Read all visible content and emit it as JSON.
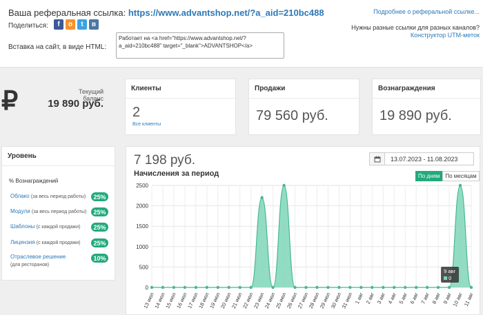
{
  "referral": {
    "label": "Ваша реферальная ссылка:",
    "url": "https://www.advantshop.net/?a_aid=210bc488",
    "more_link": "Подробнее о реферальной ссылке...",
    "share_label": "Поделиться:",
    "share_icons": [
      "facebook-icon",
      "odnoklassniki-icon",
      "twitter-icon",
      "vk-icon"
    ],
    "need_text": "Нужны разные ссылки для разных каналов?",
    "utm_link": "Конструктор UTM-меток",
    "embed_label": "Вставка на сайт, в виде HTML:",
    "embed_code": "Работает на <a href=\"https://www.advantshop.net/?a_aid=210bc488\" target=\"_blank\">ADVANTSHOP</a>"
  },
  "balance": {
    "currency_symbol": "₽",
    "label": "Текущий баланс",
    "value": "19 890 руб."
  },
  "stats": {
    "clients": {
      "title": "Клиенты",
      "value": "2",
      "sub": "Все клиенты"
    },
    "sales": {
      "title": "Продажи",
      "value": "79 560 руб."
    },
    "rewards": {
      "title": "Вознаграждения",
      "value": "19 890 руб."
    }
  },
  "level": {
    "title": "Уровень",
    "header": "% Вознаграждений",
    "items": [
      {
        "label": "Облако",
        "note": "(за весь период работы)",
        "pct": "25%"
      },
      {
        "label": "Модули",
        "note": "(за весь период работы)",
        "pct": "25%"
      },
      {
        "label": "Шаблоны",
        "note": "(с каждой продажи)",
        "pct": "25%"
      },
      {
        "label": "Лицензия",
        "note": "(с каждой продажи)",
        "pct": "25%"
      },
      {
        "label": "Отраслевое решение",
        "note": "(для ресторанов)",
        "pct": "10%"
      }
    ]
  },
  "chart_panel": {
    "total": "7 198 руб.",
    "title": "Начисления за период",
    "date_range": "13.07.2023 - 11.08.2023",
    "toggle_days": "По дням",
    "toggle_months": "По месяцам",
    "tooltip_title": "9 авг",
    "tooltip_value": "0"
  },
  "chart_data": {
    "type": "area",
    "categories": [
      "13 июл",
      "14 июл",
      "15 июл",
      "16 июл",
      "17 июл",
      "18 июл",
      "19 июл",
      "20 июл",
      "21 июл",
      "22 июл",
      "23 июл",
      "24 июл",
      "25 июл",
      "26 июл",
      "27 июл",
      "28 июл",
      "29 июл",
      "30 июл",
      "31 июл",
      "1 авг",
      "2 авг",
      "3 авг",
      "4 авг",
      "5 авг",
      "6 авг",
      "7 авг",
      "8 авг",
      "9 авг",
      "10 авг",
      "11 авг"
    ],
    "values": [
      0,
      0,
      0,
      0,
      0,
      0,
      0,
      0,
      0,
      0,
      2200,
      0,
      2500,
      0,
      0,
      0,
      0,
      0,
      0,
      0,
      0,
      0,
      0,
      0,
      0,
      0,
      0,
      0,
      2500,
      0
    ],
    "ylim": [
      0,
      2500
    ],
    "yticks": [
      0,
      500,
      1000,
      1500,
      2000,
      2500
    ],
    "grid": true,
    "colors": {
      "fill": "#7fd6b8",
      "line": "#45b892",
      "point": "#45b892"
    }
  }
}
